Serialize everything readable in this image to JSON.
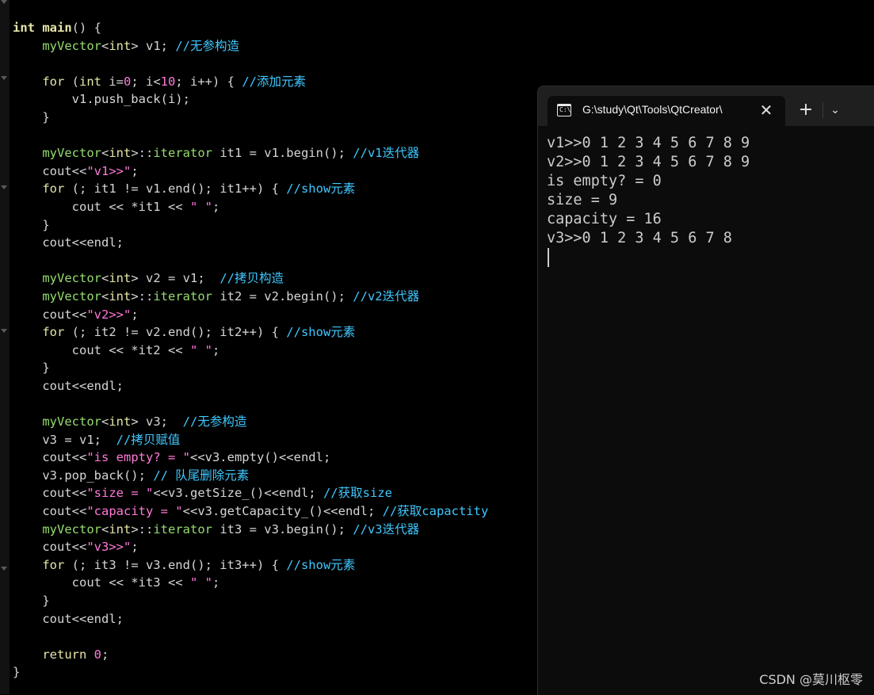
{
  "editor": {
    "lines": [
      [
        {
          "t": "kwb",
          "v": "int"
        },
        {
          "t": "pl",
          "v": " "
        },
        {
          "t": "kwb",
          "v": "main"
        },
        {
          "t": "pl",
          "v": "() {"
        }
      ],
      [
        {
          "t": "pl",
          "v": "    "
        },
        {
          "t": "ty",
          "v": "myVector"
        },
        {
          "t": "pl",
          "v": "<"
        },
        {
          "t": "kw",
          "v": "int"
        },
        {
          "t": "pl",
          "v": "> v1; "
        },
        {
          "t": "cm",
          "v": "//无参构造"
        }
      ],
      [],
      [
        {
          "t": "pl",
          "v": "    "
        },
        {
          "t": "kw",
          "v": "for"
        },
        {
          "t": "pl",
          "v": " ("
        },
        {
          "t": "kw",
          "v": "int"
        },
        {
          "t": "pl",
          "v": " i="
        },
        {
          "t": "nu",
          "v": "0"
        },
        {
          "t": "pl",
          "v": "; i<"
        },
        {
          "t": "nu",
          "v": "10"
        },
        {
          "t": "pl",
          "v": "; i++) { "
        },
        {
          "t": "cm",
          "v": "//添加元素"
        }
      ],
      [
        {
          "t": "pl",
          "v": "        v1.push_back(i);"
        }
      ],
      [
        {
          "t": "pl",
          "v": "    }"
        }
      ],
      [],
      [
        {
          "t": "pl",
          "v": "    "
        },
        {
          "t": "ty",
          "v": "myVector"
        },
        {
          "t": "pl",
          "v": "<"
        },
        {
          "t": "kw",
          "v": "int"
        },
        {
          "t": "pl",
          "v": ">::"
        },
        {
          "t": "ty",
          "v": "iterator"
        },
        {
          "t": "pl",
          "v": " it1 = v1.begin(); "
        },
        {
          "t": "cm",
          "v": "//v1迭代器"
        }
      ],
      [
        {
          "t": "pl",
          "v": "    cout<<"
        },
        {
          "t": "st",
          "v": "\"v1>>\""
        },
        {
          "t": "pl",
          "v": ";"
        }
      ],
      [
        {
          "t": "pl",
          "v": "    "
        },
        {
          "t": "kw",
          "v": "for"
        },
        {
          "t": "pl",
          "v": " (; it1 != v1.end(); it1++) { "
        },
        {
          "t": "cm",
          "v": "//show元素"
        }
      ],
      [
        {
          "t": "pl",
          "v": "        cout << *it1 << "
        },
        {
          "t": "st",
          "v": "\" \""
        },
        {
          "t": "pl",
          "v": ";"
        }
      ],
      [
        {
          "t": "pl",
          "v": "    }"
        }
      ],
      [
        {
          "t": "pl",
          "v": "    cout<<endl;"
        }
      ],
      [],
      [
        {
          "t": "pl",
          "v": "    "
        },
        {
          "t": "ty",
          "v": "myVector"
        },
        {
          "t": "pl",
          "v": "<"
        },
        {
          "t": "kw",
          "v": "int"
        },
        {
          "t": "pl",
          "v": "> v2 = v1;  "
        },
        {
          "t": "cm",
          "v": "//拷贝构造"
        }
      ],
      [
        {
          "t": "pl",
          "v": "    "
        },
        {
          "t": "ty",
          "v": "myVector"
        },
        {
          "t": "pl",
          "v": "<"
        },
        {
          "t": "kw",
          "v": "int"
        },
        {
          "t": "pl",
          "v": ">::"
        },
        {
          "t": "ty",
          "v": "iterator"
        },
        {
          "t": "pl",
          "v": " it2 = v2.begin(); "
        },
        {
          "t": "cm",
          "v": "//v2迭代器"
        }
      ],
      [
        {
          "t": "pl",
          "v": "    cout<<"
        },
        {
          "t": "st",
          "v": "\"v2>>\""
        },
        {
          "t": "pl",
          "v": ";"
        }
      ],
      [
        {
          "t": "pl",
          "v": "    "
        },
        {
          "t": "kw",
          "v": "for"
        },
        {
          "t": "pl",
          "v": " (; it2 != v2.end(); it2++) { "
        },
        {
          "t": "cm",
          "v": "//show元素"
        }
      ],
      [
        {
          "t": "pl",
          "v": "        cout << *it2 << "
        },
        {
          "t": "st",
          "v": "\" \""
        },
        {
          "t": "pl",
          "v": ";"
        }
      ],
      [
        {
          "t": "pl",
          "v": "    }"
        }
      ],
      [
        {
          "t": "pl",
          "v": "    cout<<endl;"
        }
      ],
      [],
      [
        {
          "t": "pl",
          "v": "    "
        },
        {
          "t": "ty",
          "v": "myVector"
        },
        {
          "t": "pl",
          "v": "<"
        },
        {
          "t": "kw",
          "v": "int"
        },
        {
          "t": "pl",
          "v": "> v3;  "
        },
        {
          "t": "cm",
          "v": "//无参构造"
        }
      ],
      [
        {
          "t": "pl",
          "v": "    v3 = v1;  "
        },
        {
          "t": "cm",
          "v": "//拷贝赋值"
        }
      ],
      [
        {
          "t": "pl",
          "v": "    cout<<"
        },
        {
          "t": "st",
          "v": "\"is empty? = \""
        },
        {
          "t": "pl",
          "v": "<<v3.empty()<<endl;"
        }
      ],
      [
        {
          "t": "pl",
          "v": "    v3.pop_back(); "
        },
        {
          "t": "cm",
          "v": "// 队尾删除元素"
        }
      ],
      [
        {
          "t": "pl",
          "v": "    cout<<"
        },
        {
          "t": "st",
          "v": "\"size = \""
        },
        {
          "t": "pl",
          "v": "<<v3.getSize_()<<endl; "
        },
        {
          "t": "cm",
          "v": "//获取size"
        }
      ],
      [
        {
          "t": "pl",
          "v": "    cout<<"
        },
        {
          "t": "st",
          "v": "\"capacity = \""
        },
        {
          "t": "pl",
          "v": "<<v3.getCapacity_()<<endl; "
        },
        {
          "t": "cm",
          "v": "//获取capactity"
        }
      ],
      [
        {
          "t": "pl",
          "v": "    "
        },
        {
          "t": "ty",
          "v": "myVector"
        },
        {
          "t": "pl",
          "v": "<"
        },
        {
          "t": "kw",
          "v": "int"
        },
        {
          "t": "pl",
          "v": ">::"
        },
        {
          "t": "ty",
          "v": "iterator"
        },
        {
          "t": "pl",
          "v": " it3 = v3.begin(); "
        },
        {
          "t": "cm",
          "v": "//v3迭代器"
        }
      ],
      [
        {
          "t": "pl",
          "v": "    cout<<"
        },
        {
          "t": "st",
          "v": "\"v3>>\""
        },
        {
          "t": "pl",
          "v": ";"
        }
      ],
      [
        {
          "t": "pl",
          "v": "    "
        },
        {
          "t": "kw",
          "v": "for"
        },
        {
          "t": "pl",
          "v": " (; it3 != v3.end(); it3++) { "
        },
        {
          "t": "cm",
          "v": "//show元素"
        }
      ],
      [
        {
          "t": "pl",
          "v": "        cout << *it3 << "
        },
        {
          "t": "st",
          "v": "\" \""
        },
        {
          "t": "pl",
          "v": ";"
        }
      ],
      [
        {
          "t": "pl",
          "v": "    }"
        }
      ],
      [
        {
          "t": "pl",
          "v": "    cout<<endl;"
        }
      ],
      [],
      [
        {
          "t": "pl",
          "v": "    "
        },
        {
          "t": "kw",
          "v": "return"
        },
        {
          "t": "pl",
          "v": " "
        },
        {
          "t": "nu",
          "v": "0"
        },
        {
          "t": "pl",
          "v": ";"
        }
      ],
      [
        {
          "t": "pl",
          "v": "}"
        }
      ]
    ]
  },
  "terminal": {
    "tab_title": "G:\\study\\Qt\\Tools\\QtCreator\\",
    "tab_icon": "terminal-icon",
    "tab_icon_glyph": "C:\\",
    "close_symbol": "✕",
    "new_tab_symbol": "+",
    "dropdown_symbol": "⌄",
    "output_lines": [
      "v1>>0 1 2 3 4 5 6 7 8 9",
      "v2>>0 1 2 3 4 5 6 7 8 9",
      "is empty? = 0",
      "size = 9",
      "capacity = 16",
      "v3>>0 1 2 3 4 5 6 7 8"
    ]
  },
  "watermark": "CSDN @莫川枢零",
  "colors": {
    "editor_bg": "#000000",
    "keyword": "#e6e6aa",
    "type": "#96dc6e",
    "comment": "#3fc8ff",
    "string": "#ff7ad9",
    "terminal_bg": "#0c0c0c",
    "terminal_text": "#cccccc"
  }
}
